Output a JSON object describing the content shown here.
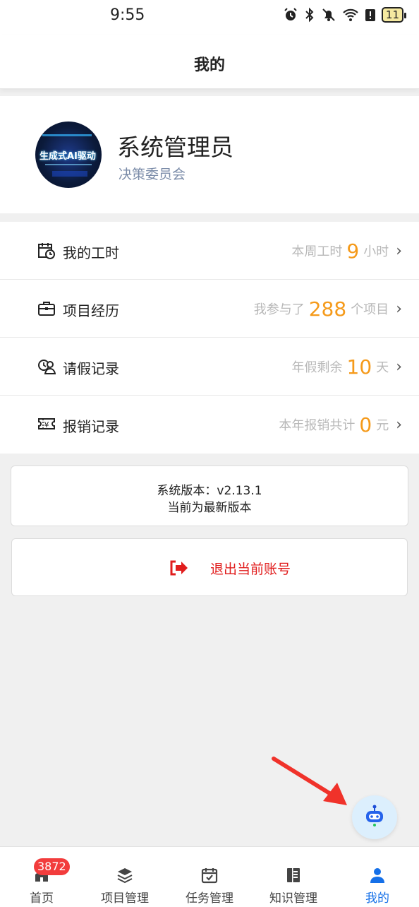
{
  "status_bar": {
    "time": "9:55",
    "battery": "11"
  },
  "navbar": {
    "title": "我的"
  },
  "profile": {
    "avatar_text": "生成式AI驱动",
    "name": "系统管理员",
    "department": "决策委员会"
  },
  "menu": [
    {
      "label": "我的工时",
      "prefix": "本周工时",
      "value": "9",
      "suffix": "小时",
      "icon": "clock-calendar-icon"
    },
    {
      "label": "项目经历",
      "prefix": "我参与了",
      "value": "288",
      "suffix": "个项目",
      "icon": "briefcase-icon"
    },
    {
      "label": "请假记录",
      "prefix": "年假剩余",
      "value": "10",
      "suffix": "天",
      "icon": "leave-person-icon"
    },
    {
      "label": "报销记录",
      "prefix": "本年报销共计",
      "value": "0",
      "suffix": "元",
      "icon": "receipt-icon"
    }
  ],
  "version": {
    "line1": "系统版本：v2.13.1",
    "line2": "当前为最新版本"
  },
  "logout": {
    "label": "退出当前账号"
  },
  "tabbar": {
    "badge": "3872",
    "tabs": [
      {
        "label": "首页",
        "icon": "home-icon"
      },
      {
        "label": "项目管理",
        "icon": "layers-icon"
      },
      {
        "label": "任务管理",
        "icon": "task-calendar-icon"
      },
      {
        "label": "知识管理",
        "icon": "book-icon"
      },
      {
        "label": "我的",
        "icon": "user-icon"
      }
    ]
  },
  "colors": {
    "accent_orange": "#f59a1a",
    "active_blue": "#1570e8",
    "logout_red": "#e11d1d",
    "badge_red": "#f23c3c"
  }
}
